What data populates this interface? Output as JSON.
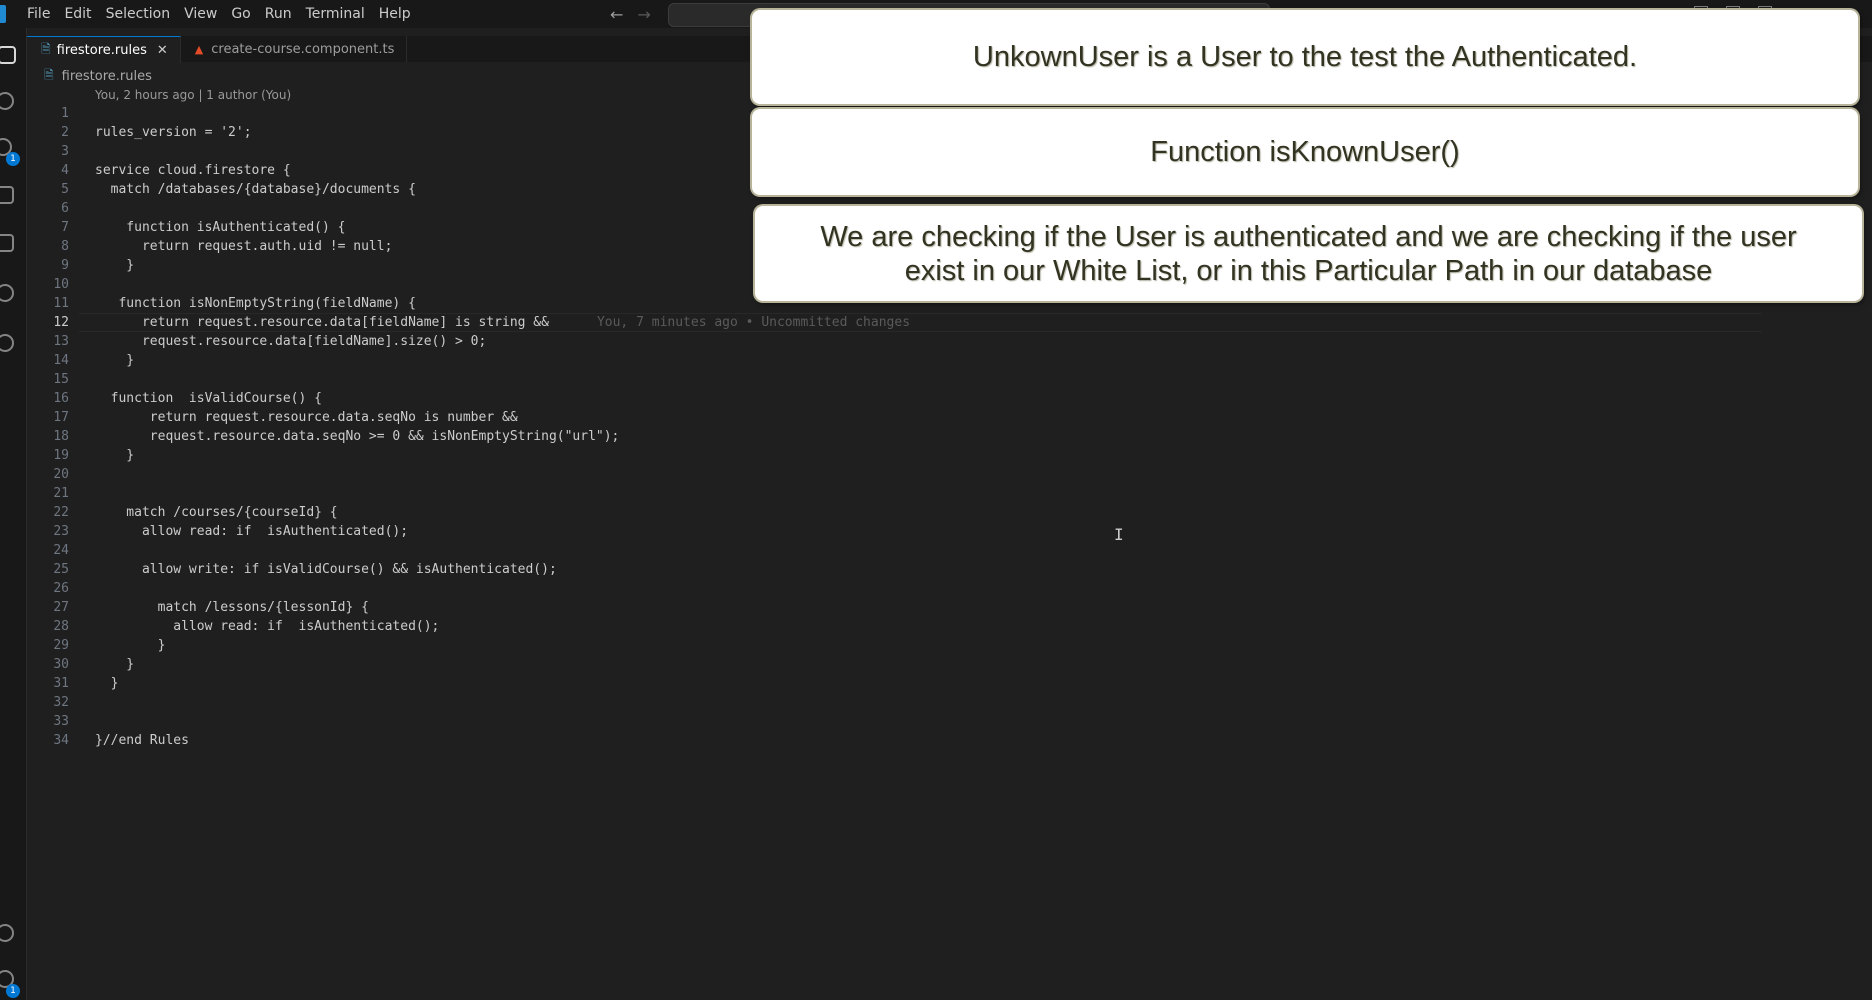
{
  "menu": [
    "File",
    "Edit",
    "Selection",
    "View",
    "Go",
    "Run",
    "Terminal",
    "Help"
  ],
  "nav": {
    "back": "←",
    "forward": "→"
  },
  "activity": {
    "scm_badge": "1",
    "settings_badge": "1"
  },
  "tabs": [
    {
      "label": "firestore.rules",
      "active": true,
      "close": "✕"
    },
    {
      "label": "create-course.component.ts",
      "active": false
    }
  ],
  "breadcrumb": {
    "file": "firestore.rules"
  },
  "codelens": "You, 2 hours ago | 1 author (You)",
  "blame": "You, 7 minutes ago • Uncommitted changes",
  "lines": [
    {
      "n": "1",
      "text": ""
    },
    {
      "n": "2",
      "text": "rules_version = '2';"
    },
    {
      "n": "3",
      "text": ""
    },
    {
      "n": "4",
      "text": "service cloud.firestore {"
    },
    {
      "n": "5",
      "text": "  match /databases/{database}/documents {"
    },
    {
      "n": "6",
      "text": ""
    },
    {
      "n": "7",
      "text": "    function isAuthenticated() {"
    },
    {
      "n": "8",
      "text": "      return request.auth.uid != null;"
    },
    {
      "n": "9",
      "text": "    }"
    },
    {
      "n": "10",
      "text": ""
    },
    {
      "n": "11",
      "text": "   function isNonEmptyString(fieldName) {"
    },
    {
      "n": "12",
      "text": "      return request.resource.data[fieldName] is string &&"
    },
    {
      "n": "13",
      "text": "      request.resource.data[fieldName].size() > 0;"
    },
    {
      "n": "14",
      "text": "    }"
    },
    {
      "n": "15",
      "text": ""
    },
    {
      "n": "16",
      "text": "  function  isValidCourse() {"
    },
    {
      "n": "17",
      "text": "       return request.resource.data.seqNo is number &&"
    },
    {
      "n": "18",
      "text": "       request.resource.data.seqNo >= 0 && isNonEmptyString(\"url\");"
    },
    {
      "n": "19",
      "text": "    }"
    },
    {
      "n": "20",
      "text": ""
    },
    {
      "n": "21",
      "text": ""
    },
    {
      "n": "22",
      "text": "    match /courses/{courseId} {"
    },
    {
      "n": "23",
      "text": "      allow read: if  isAuthenticated();"
    },
    {
      "n": "24",
      "text": ""
    },
    {
      "n": "25",
      "text": "      allow write: if isValidCourse() && isAuthenticated();"
    },
    {
      "n": "26",
      "text": ""
    },
    {
      "n": "27",
      "text": "        match /lessons/{lessonId} {"
    },
    {
      "n": "28",
      "text": "          allow read: if  isAuthenticated();"
    },
    {
      "n": "29",
      "text": "        }"
    },
    {
      "n": "30",
      "text": "    }"
    },
    {
      "n": "31",
      "text": "  }"
    },
    {
      "n": "32",
      "text": ""
    },
    {
      "n": "33",
      "text": ""
    },
    {
      "n": "34",
      "text": "}//end Rules"
    }
  ],
  "current_line": "12",
  "captions": {
    "card1": "UnkownUser is a User to the test the Authenticated.",
    "card2": "Function isKnownUser()",
    "card3": "We are checking if the User is authenticated and we are checking if the user exist in our White List, or in this Particular Path in our database"
  },
  "colors": {
    "accent": "#0078d4",
    "editor_bg": "#1f1f1f",
    "chrome_bg": "#181818"
  }
}
